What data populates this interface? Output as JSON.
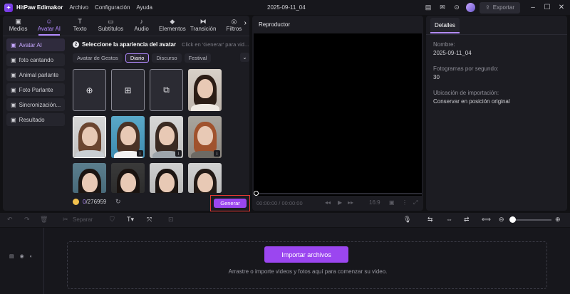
{
  "app": {
    "name": "HitPaw Edimakor",
    "menus": [
      "Archivo",
      "Configuración",
      "Ayuda"
    ],
    "doc_title": "2025-09-11_04",
    "export_label": "Exportar"
  },
  "tabs": [
    {
      "label": "Medios",
      "icon": "media-icon"
    },
    {
      "label": "Avatar AI",
      "icon": "avatar-ai-icon",
      "active": true
    },
    {
      "label": "Texto",
      "icon": "text-icon"
    },
    {
      "label": "Subtítulos",
      "icon": "subtitles-icon"
    },
    {
      "label": "Audio",
      "icon": "audio-icon"
    },
    {
      "label": "Elementos",
      "icon": "elements-icon"
    },
    {
      "label": "Transición",
      "icon": "transition-icon"
    },
    {
      "label": "Filtros",
      "icon": "filters-icon"
    }
  ],
  "sidebar": {
    "items": [
      {
        "label": "Avatar AI",
        "active": true
      },
      {
        "label": "foto cantando"
      },
      {
        "label": "Animal parlante"
      },
      {
        "label": "Foto Parlante"
      },
      {
        "label": "Sincronización..."
      },
      {
        "label": "Resultado"
      }
    ]
  },
  "avatar_panel": {
    "step_number": "2",
    "step_title": "Seleccione la apariencia del avatar",
    "step_hint": "Click en 'Generar' para vid...",
    "categories": [
      {
        "label": "Avatar de Gestos"
      },
      {
        "label": "Diario",
        "active": true
      },
      {
        "label": "Discurso"
      },
      {
        "label": "Festival"
      }
    ],
    "credits_used": "0",
    "credits_total": "/276959",
    "generate_label": "Generar"
  },
  "player": {
    "title": "Reproductor",
    "time": "00:00:00 / 00:00:00",
    "aspect": "16:9"
  },
  "details": {
    "tab_label": "Detalles",
    "fields": [
      {
        "label": "Nombre:",
        "value": "2025-09-11_04"
      },
      {
        "label": "Fotogramas por segundo:",
        "value": "30"
      },
      {
        "label": "Ubicación de importación:",
        "value": "Conservar en posición original"
      }
    ]
  },
  "timeline": {
    "split_label": "Separar",
    "import_label": "Importar archivos",
    "drop_hint": "Arrastre o importe videos y fotos aquí para comenzar su video."
  },
  "colors": {
    "accent": "#9b46f0",
    "accent_light": "#b38bff",
    "highlight_border": "#e53935",
    "panel": "#1c1c22",
    "background": "#111114"
  }
}
